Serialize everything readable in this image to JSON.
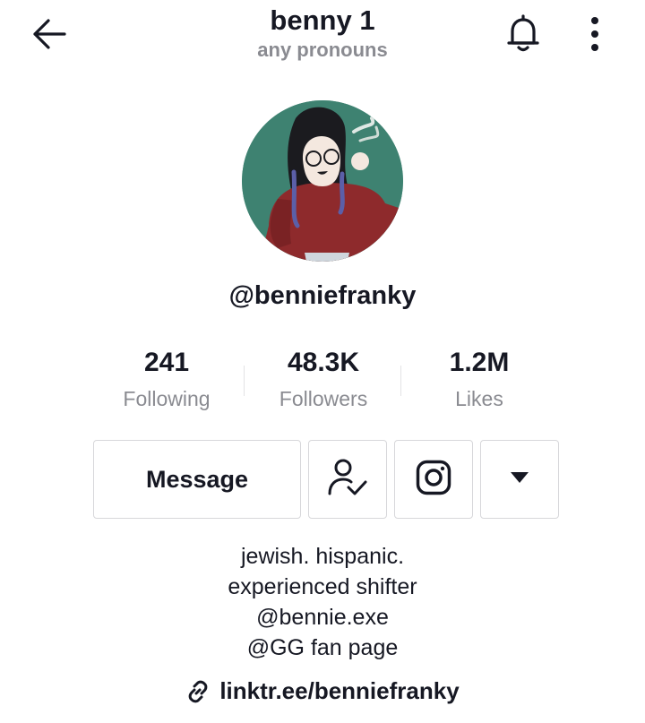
{
  "header": {
    "title": "benny 1",
    "subtitle": "any pronouns",
    "icons": {
      "back": "arrow-left-icon",
      "notifications": "bell-icon",
      "more": "more-vertical-icon"
    }
  },
  "profile": {
    "handle": "@benniefranky",
    "avatar_accent": "#3e8271"
  },
  "stats": [
    {
      "value": "241",
      "label": "Following"
    },
    {
      "value": "48.3K",
      "label": "Followers"
    },
    {
      "value": "1.2M",
      "label": "Likes"
    }
  ],
  "actions": {
    "message_label": "Message",
    "icons": {
      "following": "user-check-icon",
      "instagram": "instagram-icon",
      "dropdown": "caret-down-icon"
    }
  },
  "bio": {
    "lines": [
      "jewish. hispanic.",
      "experienced shifter",
      "@bennie.exe",
      "@GG fan page"
    ]
  },
  "link": {
    "text": "linktr.ee/benniefranky",
    "icon": "link-icon"
  }
}
